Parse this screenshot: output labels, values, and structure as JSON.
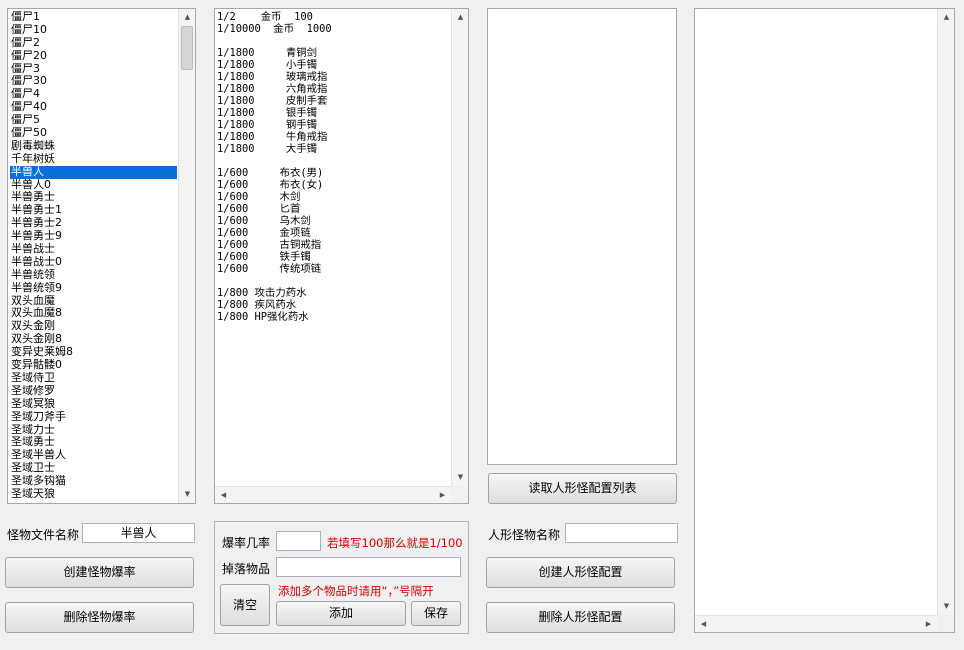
{
  "monster_list": {
    "items": [
      "僵尸1",
      "僵尸10",
      "僵尸2",
      "僵尸20",
      "僵尸3",
      "僵尸30",
      "僵尸4",
      "僵尸40",
      "僵尸5",
      "僵尸50",
      "剧毒蜘蛛",
      "千年树妖",
      "半兽人",
      "半兽人0",
      "半兽勇士",
      "半兽勇士1",
      "半兽勇士2",
      "半兽勇士9",
      "半兽战士",
      "半兽战士0",
      "半兽统领",
      "半兽统领9",
      "双头血魔",
      "双头血魔8",
      "双头金刚",
      "双头金刚8",
      "变异史莱姆8",
      "变异骷髅0",
      "圣域侍卫",
      "圣域修罗",
      "圣域冥狼",
      "圣域刀斧手",
      "圣域力士",
      "圣域勇士",
      "圣域半兽人",
      "圣域卫士",
      "圣域多钩猫",
      "圣域天狼"
    ],
    "selected_index": 12
  },
  "drop_text": {
    "lines": [
      "1/2    金币  100",
      "1/10000  金币  1000",
      "",
      "1/1800     青铜剑",
      "1/1800     小手镯",
      "1/1800     玻璃戒指",
      "1/1800     六角戒指",
      "1/1800     皮制手套",
      "1/1800     银手镯",
      "1/1800     钢手镯",
      "1/1800     牛角戒指",
      "1/1800     大手镯",
      "",
      "1/600     布衣(男)",
      "1/600     布衣(女)",
      "1/600     木剑",
      "1/600     匕首",
      "1/600     乌木剑",
      "1/600     金项链",
      "1/600     古铜戒指",
      "1/600     铁手镯",
      "1/600     传统项链",
      "",
      "1/800 攻击力药水",
      "1/800 疾风药水",
      "1/800 HP强化药水"
    ]
  },
  "left_controls": {
    "file_label": "怪物文件名称",
    "file_value": "半兽人",
    "create_button": "创建怪物爆率",
    "delete_button": "删除怪物爆率"
  },
  "middle_controls": {
    "rate_label": "爆率几率",
    "rate_value": "",
    "rate_hint": "若填写100那么就是1/100",
    "item_label": "掉落物品",
    "item_value": "",
    "item_hint": "添加多个物品时请用“，”号隔开",
    "clear_button": "清空",
    "add_button": "添加",
    "save_button": "保存"
  },
  "humanoid": {
    "read_button": "读取人形怪配置列表",
    "name_label": "人形怪物名称",
    "name_value": "",
    "create_button": "创建人形怪配置",
    "delete_button": "删除人形怪配置"
  },
  "icons": {
    "up": "▲",
    "down": "▼",
    "left": "◀",
    "right": "▶"
  }
}
